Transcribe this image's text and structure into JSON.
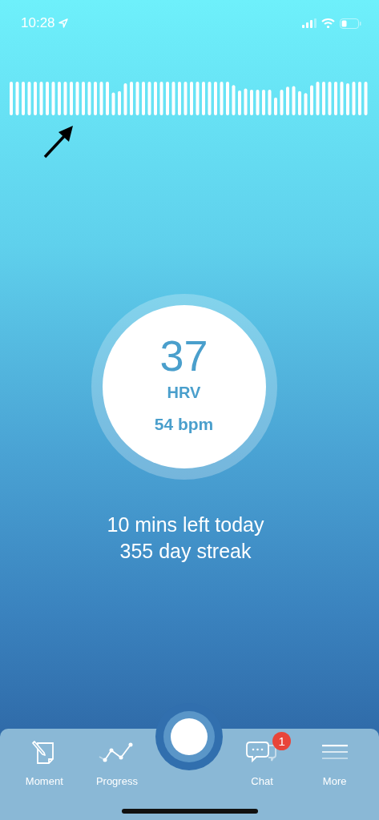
{
  "status_bar": {
    "time": "10:28"
  },
  "hrv_dial": {
    "value": "37",
    "label": "HRV",
    "heart_rate": "54 bpm"
  },
  "summary": [
    "10 mins left today",
    "355 day streak"
  ],
  "tab_bar": {
    "items": [
      {
        "label": "Moment",
        "kind": "moment"
      },
      {
        "label": "Progress",
        "kind": "progress"
      },
      {
        "kind": "center"
      },
      {
        "label": "Chat",
        "kind": "chat",
        "badge": "1"
      },
      {
        "label": "More",
        "kind": "more"
      }
    ]
  }
}
